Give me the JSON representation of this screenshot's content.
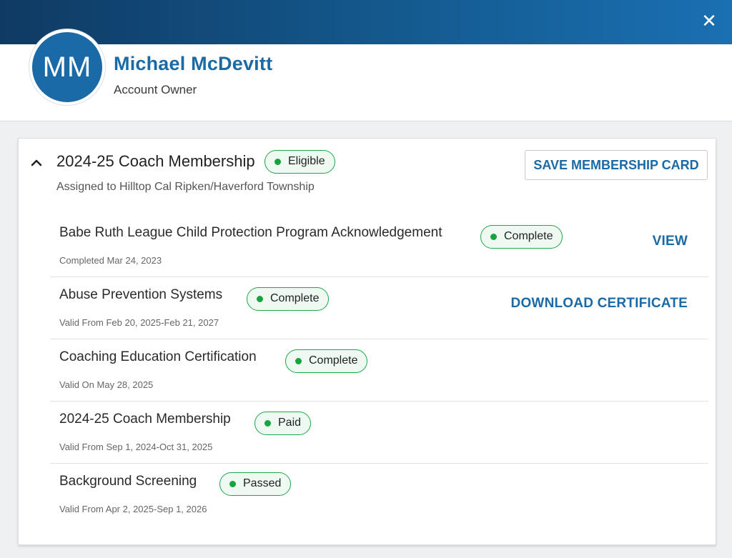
{
  "window": {
    "close_icon": "close-icon"
  },
  "user": {
    "initials": "MM",
    "name": "Michael McDevitt",
    "role": "Account Owner"
  },
  "membership": {
    "title": "2024-25 Coach Membership",
    "status": "Eligible",
    "assigned": "Assigned to Hilltop Cal Ripken/Haverford Township",
    "save_button": "SAVE MEMBERSHIP CARD",
    "expanded_icon": "chevron-up-icon",
    "requirements": [
      {
        "title": "Babe Ruth League Child Protection Program Acknowledgement",
        "status": "Complete",
        "detail": "Completed Mar 24, 2023",
        "action": "VIEW"
      },
      {
        "title": "Abuse Prevention Systems",
        "status": "Complete",
        "detail": "Valid From Feb 20, 2025-Feb 21, 2027",
        "action": "DOWNLOAD CERTIFICATE"
      },
      {
        "title": "Coaching Education Certification",
        "status": "Complete",
        "detail": "Valid On May 28, 2025",
        "action": ""
      },
      {
        "title": "2024-25 Coach Membership",
        "status": "Paid",
        "detail": "Valid From Sep 1, 2024-Oct 31, 2025",
        "action": ""
      },
      {
        "title": "Background Screening",
        "status": "Passed",
        "detail": "Valid From Apr 2, 2025-Sep 1, 2026",
        "action": ""
      }
    ]
  },
  "colors": {
    "header_gradient_start": "#0f3a63",
    "header_gradient_end": "#1a70b3",
    "accent": "#1a6aa5",
    "status_green": "#16a340"
  }
}
